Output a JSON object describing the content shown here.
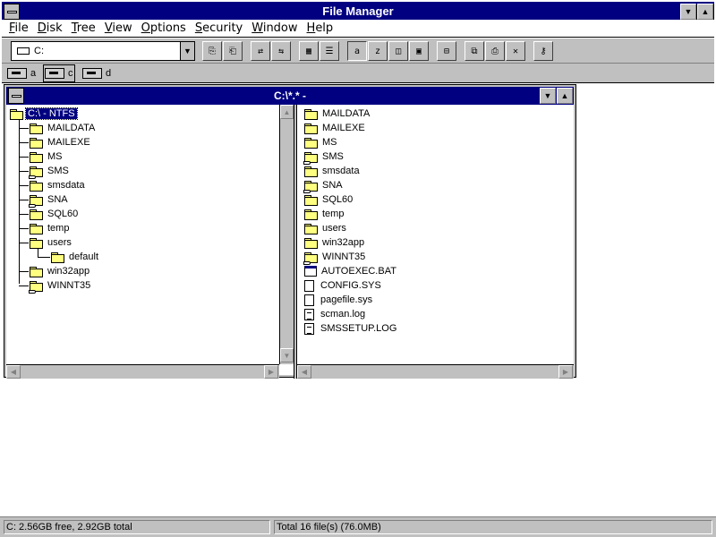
{
  "window": {
    "title": "File Manager"
  },
  "menu": [
    "File",
    "Disk",
    "Tree",
    "View",
    "Options",
    "Security",
    "Window",
    "Help"
  ],
  "toolbar": {
    "drive_combo_value": "C:"
  },
  "drives": [
    {
      "letter": "a",
      "type": "floppy",
      "selected": false
    },
    {
      "letter": "c",
      "type": "hard-disk",
      "selected": true
    },
    {
      "letter": "d",
      "type": "cd-rom",
      "selected": false
    }
  ],
  "child_window": {
    "title": "C:\\*.* -"
  },
  "tree": {
    "root": "C:\\ - NTFS",
    "items": [
      {
        "name": "MAILDATA",
        "shared": false
      },
      {
        "name": "MAILEXE",
        "shared": false
      },
      {
        "name": "MS",
        "shared": false
      },
      {
        "name": "SMS",
        "shared": true
      },
      {
        "name": "smsdata",
        "shared": false
      },
      {
        "name": "SNA",
        "shared": true
      },
      {
        "name": "SQL60",
        "shared": false
      },
      {
        "name": "temp",
        "shared": false
      },
      {
        "name": "users",
        "shared": false
      },
      {
        "name": "default",
        "shared": false
      },
      {
        "name": "win32app",
        "shared": false
      },
      {
        "name": "WINNT35",
        "shared": true
      }
    ]
  },
  "files": [
    {
      "name": "MAILDATA",
      "kind": "folder",
      "shared": false
    },
    {
      "name": "MAILEXE",
      "kind": "folder",
      "shared": false
    },
    {
      "name": "MS",
      "kind": "folder",
      "shared": false
    },
    {
      "name": "SMS",
      "kind": "folder",
      "shared": true
    },
    {
      "name": "smsdata",
      "kind": "folder",
      "shared": false
    },
    {
      "name": "SNA",
      "kind": "folder",
      "shared": true
    },
    {
      "name": "SQL60",
      "kind": "folder",
      "shared": false
    },
    {
      "name": "temp",
      "kind": "folder",
      "shared": false
    },
    {
      "name": "users",
      "kind": "folder",
      "shared": false
    },
    {
      "name": "win32app",
      "kind": "folder",
      "shared": false
    },
    {
      "name": "WINNT35",
      "kind": "folder",
      "shared": true
    },
    {
      "name": "AUTOEXEC.BAT",
      "kind": "program"
    },
    {
      "name": "CONFIG.SYS",
      "kind": "file"
    },
    {
      "name": "pagefile.sys",
      "kind": "file"
    },
    {
      "name": "scman.log",
      "kind": "document"
    },
    {
      "name": "SMSSETUP.LOG",
      "kind": "document"
    }
  ],
  "status": {
    "left": "C: 2.56GB free,  2.92GB total",
    "right": "Total 16 file(s) (76.0MB)"
  }
}
